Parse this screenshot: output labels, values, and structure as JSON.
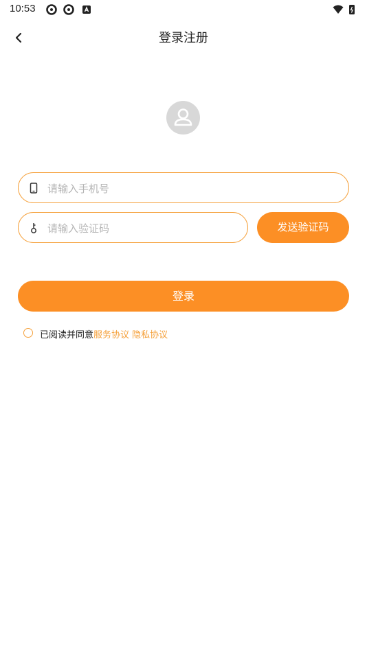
{
  "status_bar": {
    "time": "10:53"
  },
  "header": {
    "title": "登录注册"
  },
  "form": {
    "phone_placeholder": "请输入手机号",
    "code_placeholder": "请输入验证码",
    "send_code_label": "发送验证码",
    "login_label": "登录"
  },
  "agreement": {
    "prefix": "已阅读并同意",
    "service_link": "服务协议",
    "privacy_link": "隐私协议"
  },
  "colors": {
    "accent": "#fc8f25",
    "border": "#f5a03a",
    "avatar_bg": "#d8d8d8",
    "placeholder": "#b5b5b5"
  },
  "icons": [
    "back-icon",
    "avatar-icon",
    "phone-icon",
    "key-icon",
    "wifi-icon",
    "battery-icon",
    "settings-icon",
    "app-icon"
  ]
}
